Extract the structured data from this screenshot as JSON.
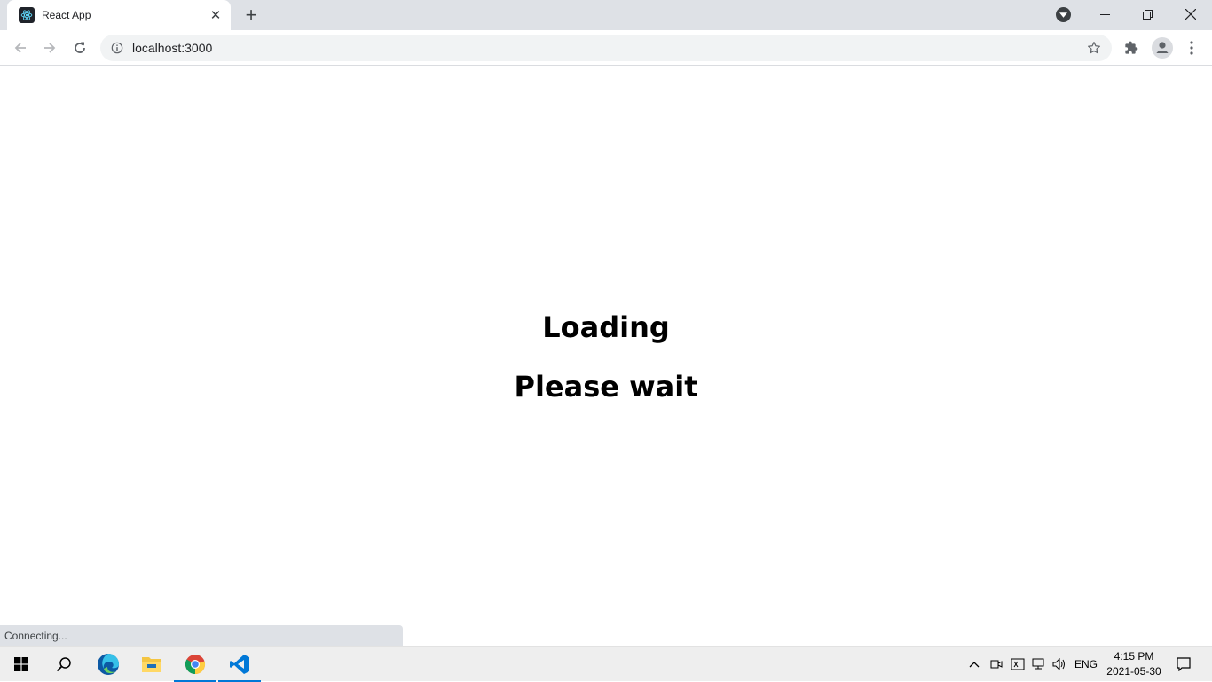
{
  "browser": {
    "tab": {
      "title": "React App"
    },
    "url": "localhost:3000",
    "status_text": "Connecting..."
  },
  "page": {
    "heading1": "Loading",
    "heading2": "Please wait"
  },
  "taskbar": {
    "language": "ENG",
    "time": "4:15 PM",
    "date": "2021-05-30",
    "apps": [
      "start-icon",
      "search-icon",
      "edge-icon",
      "file-explorer-icon",
      "chrome-icon",
      "vscode-icon"
    ]
  },
  "colors": {
    "tabstrip": "#dee1e6",
    "omnibox": "#f1f3f4",
    "taskbar": "#eeeeee",
    "active_indicator": "#0078d7"
  }
}
